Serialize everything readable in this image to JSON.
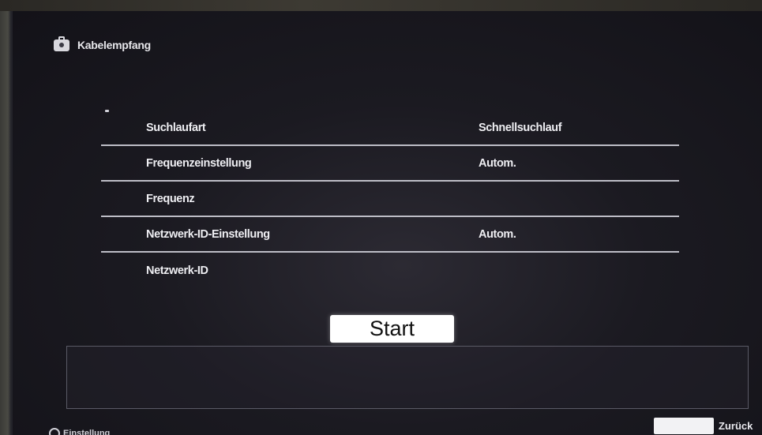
{
  "header": {
    "title": "Kabelempfang",
    "icon": "toolbox-icon"
  },
  "menu": {
    "items": [
      {
        "label": "Suchlaufart",
        "value": "Schnellsuchlauf"
      },
      {
        "label": "Frequenzeinstellung",
        "value": "Autom."
      },
      {
        "label": "Frequenz",
        "value": ""
      },
      {
        "label": "Netzwerk-ID-Einstellung",
        "value": "Autom."
      },
      {
        "label": "Netzwerk-ID",
        "value": ""
      }
    ]
  },
  "start_button": {
    "label": "Start"
  },
  "footer": {
    "left_label": "Einstellung",
    "back_label": "Zurück"
  }
}
